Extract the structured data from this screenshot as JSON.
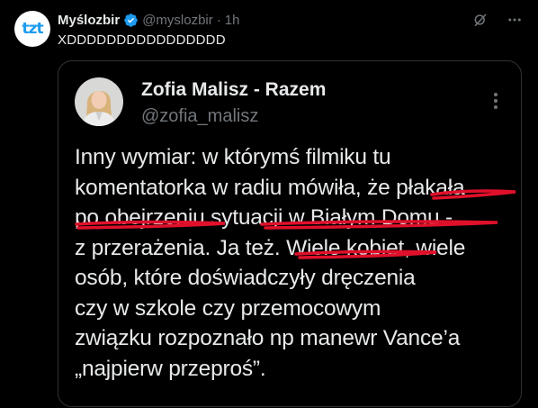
{
  "post": {
    "avatar_text": "tzt",
    "display_name": "Myślozbir",
    "handle": "@myslozbir",
    "separator": "·",
    "time": "1h",
    "text": "XDDDDDDDDDDDDDDDD"
  },
  "quote": {
    "display_name": "Zofia Malisz - Razem",
    "handle": "@zofia_malisz",
    "lines": [
      "Inny wymiar: w którymś filmiku tu",
      "komentatorka w radiu mówiła, że płakała",
      "po obejrzeniu sytuacji w Białym Domu -",
      "z przerażenia. Ja też. Wiele kobiet, wiele",
      "osób, które doświadczyły dręczenia",
      "czy w szkole czy przemocowym",
      "związku rozpoznało np manewr Vance’a",
      "„najpierw przeproś”."
    ]
  },
  "colors": {
    "background": "#000000",
    "text": "#e7e9ea",
    "muted": "#71767b",
    "verified": "#1d9bf0",
    "underline": "#e0102a",
    "border": "#2f3336"
  },
  "icons": [
    "verified-badge-icon",
    "grok-icon",
    "more-icon"
  ]
}
